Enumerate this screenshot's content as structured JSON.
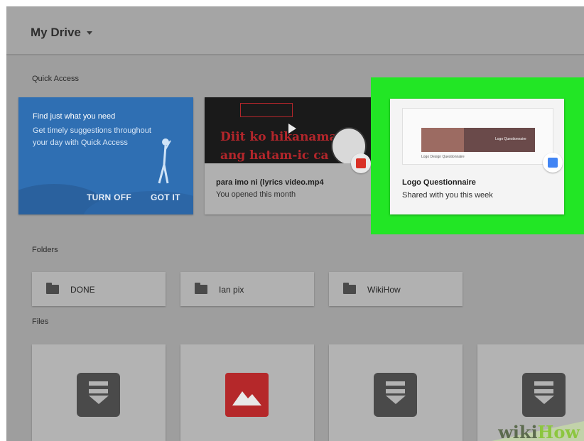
{
  "header": {
    "title": "My Drive"
  },
  "quick_access": {
    "label": "Quick Access",
    "promo": {
      "heading": "Find just what you need",
      "line1": "Get timely suggestions throughout",
      "line2": "your day with Quick Access",
      "turn_off": "TURN OFF",
      "got_it": "GOT IT"
    },
    "video": {
      "thumb_line1": "Diit ko hikanaman",
      "thumb_line2": "ang hatam-ic ca",
      "title": "para imo ni (lyrics video.mp4",
      "subtitle": "You opened this month",
      "badge_color": "#d93025"
    },
    "doc": {
      "preview_caption": "Logo Design Questionnaire",
      "banner_text": "Logo Questionnaire",
      "title": "Logo Questionnaire",
      "subtitle": "Shared with you this week",
      "badge_color": "#4285f4"
    },
    "highlight_color": "#22e625"
  },
  "folders": {
    "label": "Folders",
    "items": [
      {
        "name": "DONE",
        "icon": "folder-icon"
      },
      {
        "name": "Ian pix",
        "icon": "shared-folder-icon"
      },
      {
        "name": "WikiHow",
        "icon": "folder-icon"
      }
    ]
  },
  "files": {
    "label": "Files",
    "items": [
      {
        "icon": "download-doc-icon"
      },
      {
        "icon": "image-icon"
      },
      {
        "icon": "download-doc-icon"
      },
      {
        "icon": "download-doc-icon"
      }
    ]
  },
  "watermark": {
    "part1": "wiki",
    "part2": "How"
  }
}
